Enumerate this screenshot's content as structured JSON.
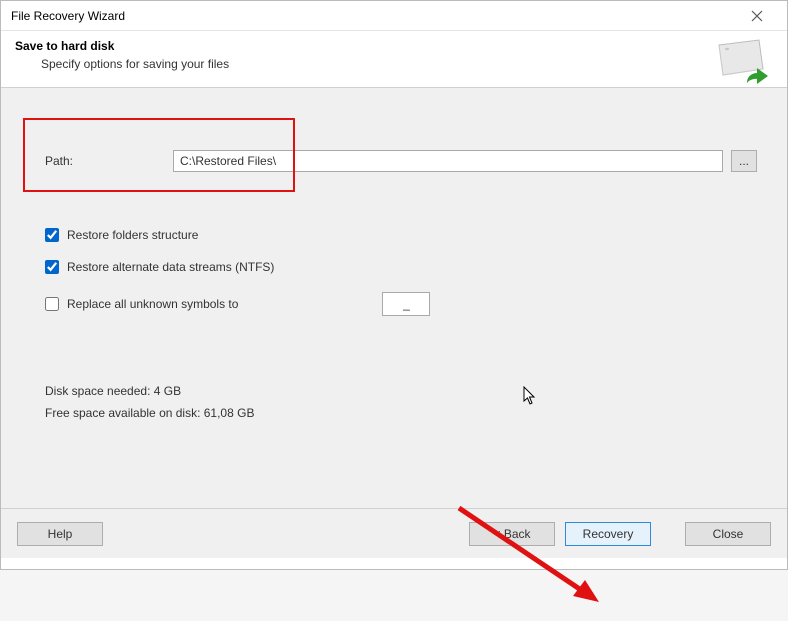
{
  "titlebar": {
    "title": "File Recovery Wizard"
  },
  "header": {
    "title": "Save to hard disk",
    "subtitle": "Specify options for saving your files"
  },
  "path": {
    "label": "Path:",
    "value": "C:\\Restored Files\\",
    "browse_label": "..."
  },
  "options": {
    "restore_folders": {
      "label": "Restore folders structure",
      "checked": true
    },
    "restore_ads": {
      "label": "Restore alternate data streams (NTFS)",
      "checked": true
    },
    "replace_symbols": {
      "label": "Replace all unknown symbols to",
      "checked": false,
      "value": "_"
    }
  },
  "info": {
    "needed": "Disk space needed: 4 GB",
    "free": "Free space available on disk: 61,08 GB"
  },
  "footer": {
    "help": "Help",
    "back": "< Back",
    "recovery": "Recovery",
    "close": "Close"
  }
}
